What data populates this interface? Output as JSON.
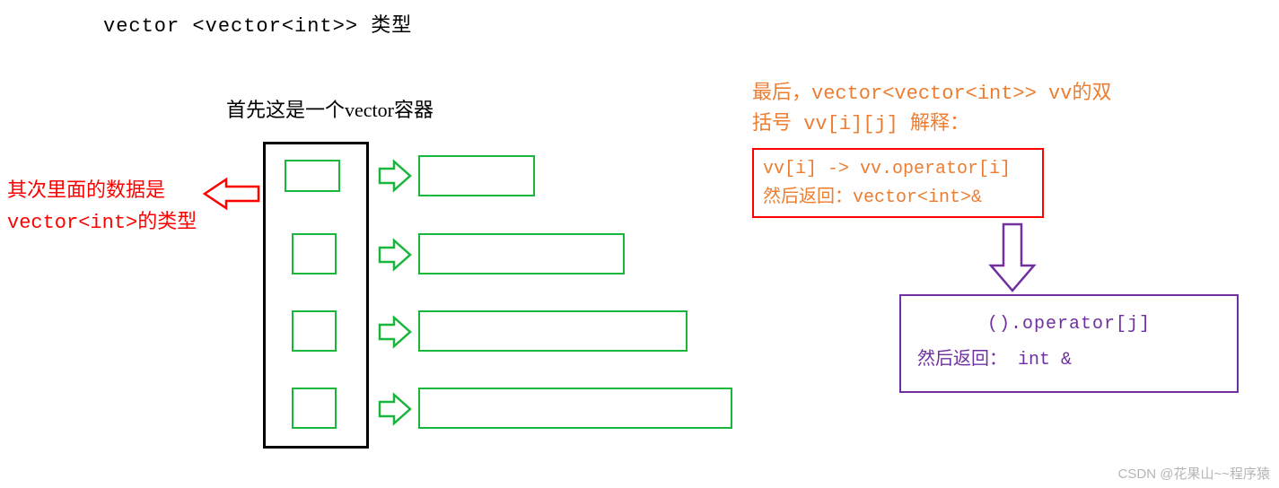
{
  "title": "vector <vector<int>> 类型",
  "subtitle": "首先这是一个vector容器",
  "left_note_line1": "其次里面的数据是",
  "left_note_line2": "vector<int>的类型",
  "orange_note_line1": "最后，vector<vector<int>>  vv的双",
  "orange_note_line2": "括号 vv[i][j] 解释：",
  "red_box_line1": "vv[i] -> vv.operator[i]",
  "red_box_line2": "然后返回：vector<int>&",
  "purple_box_line1": "().operator[j]",
  "purple_box_line2": "然后返回：  int &",
  "watermark": "CSDN @花果山~~程序猿",
  "colors": {
    "red": "#ff0000",
    "green": "#18b63b",
    "orange": "#ed7d31",
    "purple": "#7030a0"
  },
  "chart_data": {
    "type": "diagram",
    "outer_container": "black-bordered vertical box (vector<vector<int>>)",
    "rows": 4,
    "bar_widths_relative": [
      130,
      230,
      300,
      350
    ],
    "note": "Each cell inside the black box represents a vector<int> element; arrows point to green bars of increasing length representing the inner vector<int> storage."
  }
}
